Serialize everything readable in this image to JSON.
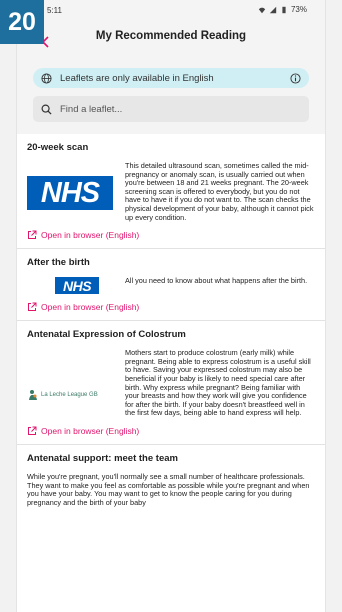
{
  "badge": "20",
  "status": {
    "time": "5:11",
    "battery": "73%"
  },
  "header": {
    "title": "My Recommended Reading"
  },
  "info_banner": {
    "text": "Leaflets are only available in English"
  },
  "search": {
    "placeholder": "Find a leaflet..."
  },
  "items": [
    {
      "title": "20-week scan",
      "logo": "NHS",
      "description": "This detailed ultrasound scan, sometimes called the mid-pregnancy or anomaly scan, is usually carried out when you're between 18 and 21 weeks pregnant. The 20-week screening scan is offered to everybody, but you do not have to have it if you do not want to. The scan checks the physical development of your baby, although it cannot pick up every condition.",
      "link": "Open in browser (English)"
    },
    {
      "title": "After the birth",
      "logo": "NHS",
      "description": "All you need to know about what happens after the birth.",
      "link": "Open in browser (English)"
    },
    {
      "title": "Antenatal Expression of Colostrum",
      "logo": "La Leche League GB",
      "description": "Mothers start to produce colostrum (early milk) while pregnant. Being able to express colostrum is a useful skill to have. Saving your expressed colostrum may also be beneficial if your baby is likely to need special care after birth. Why express while pregnant? Being familiar with your breasts and how they work will give you confidence for after the birth. If your baby doesn't breastfeed well in the first few days, being able to hand express will help.",
      "link": "Open in browser (English)"
    },
    {
      "title": "Antenatal support: meet the team",
      "description": "While you're pregnant, you'll normally see a small number of healthcare professionals. They want to make you feel as comfortable as possible while you're pregnant and when you have your baby. You may want to get to know the people caring for you during pregnancy and the birth of your baby"
    }
  ],
  "colors": {
    "accent": "#e0156d",
    "nhs_blue": "#005eb8",
    "banner": "#cfeff4",
    "badge": "#1f6f9e"
  }
}
